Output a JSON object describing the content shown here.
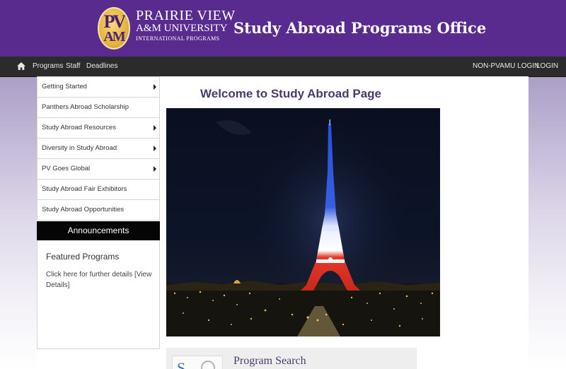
{
  "header": {
    "logo_monogram_top": "PV",
    "logo_monogram_bottom": "AM",
    "logo_line1": "PRAIRIE VIEW",
    "logo_line2": "A&M UNIVERSITY",
    "logo_line3": "INTERNATIONAL PROGRAMS",
    "site_title": "Study Abroad Programs Office",
    "background_color": "#5a2b8e"
  },
  "navbar": {
    "home_icon": "home-icon",
    "items": [
      "Programs",
      "Staff",
      "Deadlines"
    ],
    "right_items": [
      "NON-PVAMU LOGIN",
      "LOGIN"
    ]
  },
  "sidebar": {
    "items": [
      {
        "label": "Getting Started",
        "has_submenu": true
      },
      {
        "label": "Panthers Abroad Scholarship",
        "has_submenu": false
      },
      {
        "label": "Study Abroad Resources",
        "has_submenu": true
      },
      {
        "label": "Diversity in Study Abroad",
        "has_submenu": true
      },
      {
        "label": "PV Goes Global",
        "has_submenu": true
      },
      {
        "label": "Study Abroad Fair Exhibitors",
        "has_submenu": false
      },
      {
        "label": "Study Abroad Opportunities",
        "has_submenu": false
      }
    ],
    "announcements_label": "Announcements",
    "featured_title": "Featured Programs",
    "featured_body": "Click here for further details [View Details]"
  },
  "main": {
    "welcome_heading": "Welcome to Study Abroad Page",
    "hero_image": "eiffel-tower-night-photo",
    "program_search_title": "Program Search"
  }
}
